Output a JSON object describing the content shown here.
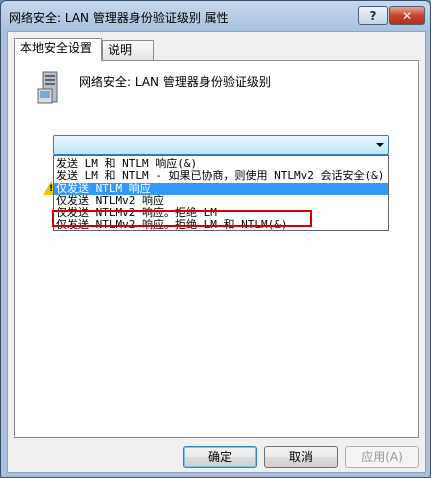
{
  "window": {
    "title": "网络安全: LAN 管理器身份验证级别 属性",
    "help_label": "?",
    "close_label": "✕"
  },
  "tabs": [
    {
      "label": "本地安全设置",
      "active": true
    },
    {
      "label": "说明",
      "active": false
    }
  ],
  "panel": {
    "policy_icon": "server-icon",
    "policy_title": "网络安全: LAN 管理器身份验证级别",
    "combo_value": ""
  },
  "dropdown": {
    "options": [
      "发送 LM 和 NTLM 响应(&)",
      "发送 LM 和 NTLM - 如果已协商，则使用 NTLMv2 会话安全(&)",
      "仅发送 NTLM 响应",
      "仅发送 NTLMv2 响应",
      "仅发送 NTLMv2 响应。拒绝 LM",
      "仅发送 NTLMv2 响应。拒绝 LM 和 NTLM(&)"
    ],
    "selected_index": 2
  },
  "buttons": {
    "ok": "确定",
    "cancel": "取消",
    "apply": "应用(A)"
  },
  "colors": {
    "highlight": "#3399ff",
    "annotation": "#d40000"
  }
}
